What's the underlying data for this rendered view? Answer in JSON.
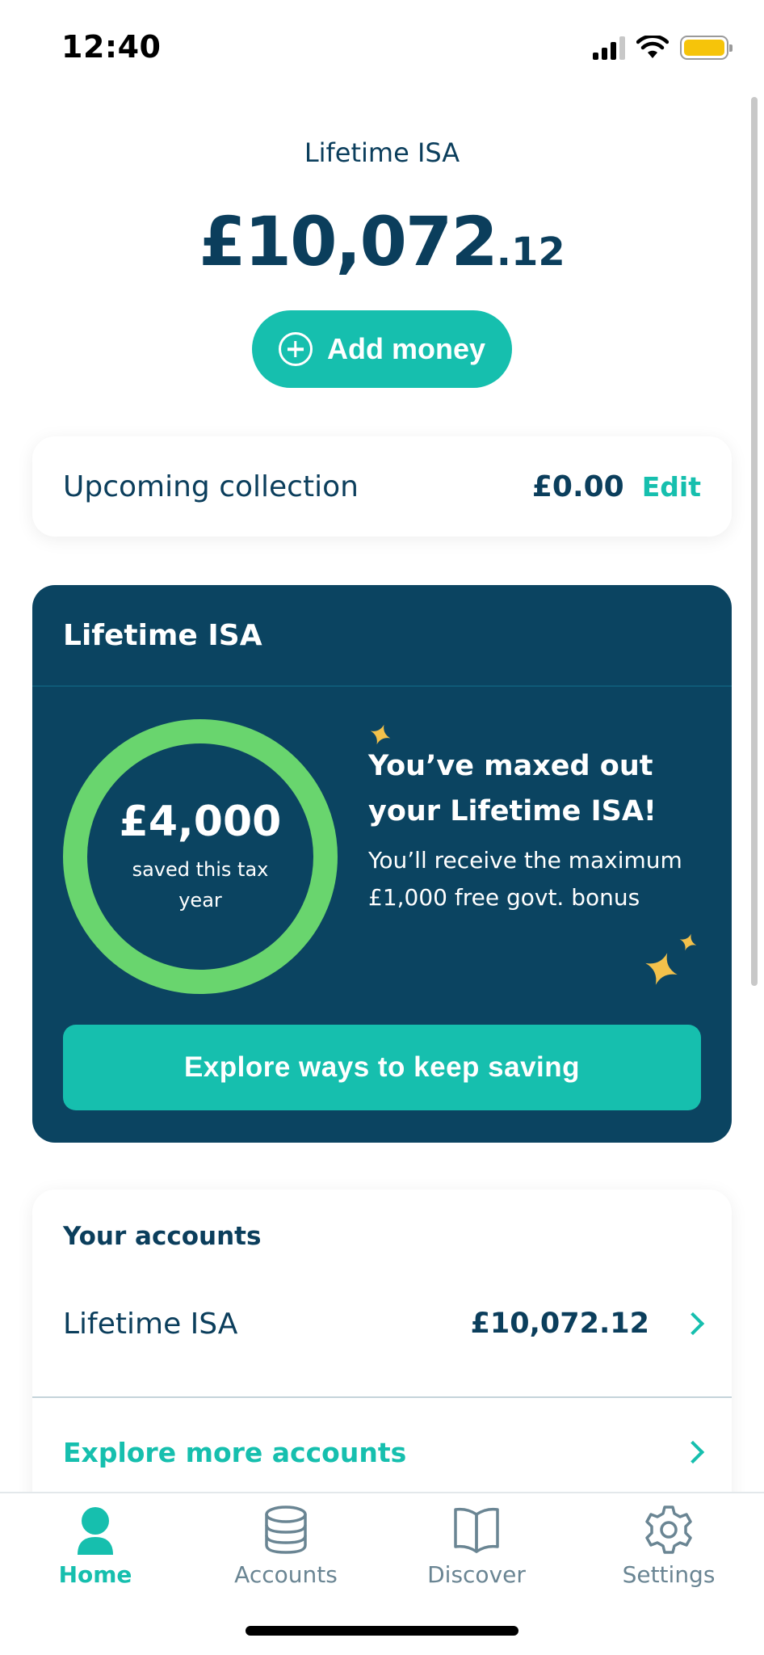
{
  "status_bar": {
    "time": "12:40",
    "battery_color": "#f6c40a"
  },
  "header": {
    "account_title": "Lifetime ISA",
    "balance_major": "£10,072",
    "balance_minor": ".12",
    "add_money_label": "Add money"
  },
  "upcoming": {
    "label": "Upcoming collection",
    "amount": "£0.00",
    "edit_label": "Edit"
  },
  "lisa_card": {
    "title": "Lifetime ISA",
    "saved_amount": "£4,000",
    "saved_caption": "saved this tax year",
    "progress_fraction": 1.0,
    "maxed_title": "You’ve maxed out your Lifetime ISA!",
    "maxed_sub": "You’ll receive the maximum £1,000 free govt. bonus",
    "cta_label": "Explore ways to keep saving"
  },
  "accounts": {
    "heading": "Your accounts",
    "items": [
      {
        "name": "Lifetime ISA",
        "value": "£10,072.12"
      }
    ],
    "explore_label": "Explore more accounts"
  },
  "tabs": [
    {
      "label": "Home",
      "icon": "person-icon",
      "active": true
    },
    {
      "label": "Accounts",
      "icon": "database-icon",
      "active": false
    },
    {
      "label": "Discover",
      "icon": "book-icon",
      "active": false
    },
    {
      "label": "Settings",
      "icon": "gear-icon",
      "active": false
    }
  ],
  "colors": {
    "accent": "#16bfae",
    "navy": "#0b3e5c",
    "card_navy": "#0b4461",
    "ring_green": "#69d56e",
    "sparkle_yellow": "#f3c14b"
  }
}
